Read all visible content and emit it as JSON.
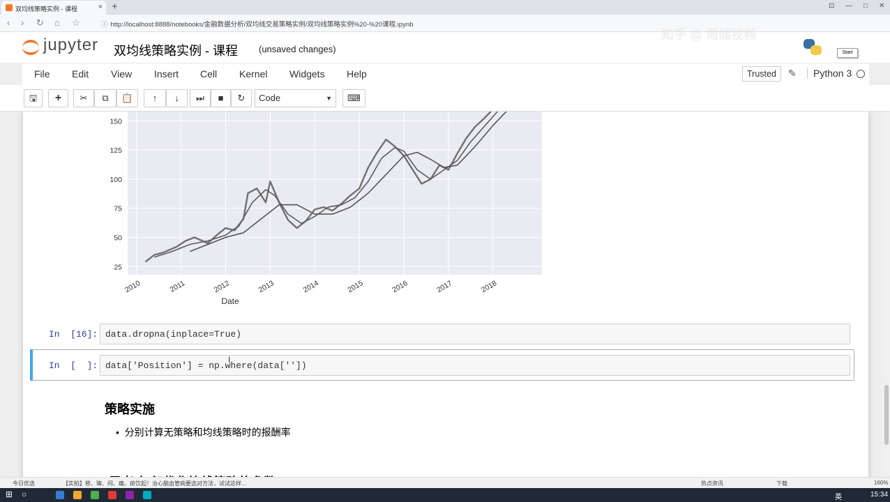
{
  "browser": {
    "tab_title": "双均线策略实例 - 课程",
    "tab_close": "×",
    "new_tab": "+",
    "url_lock": "ⓘ",
    "url": "http://localhost:8888/notebooks/金融数据分析/双均线交易策略实例/双均线策略实例%20-%20课程.ipynb",
    "watermark": "知乎 @ 周储视频"
  },
  "header": {
    "logo_text": "jupyter",
    "notebook_title": "双均线策略实例 - 课程",
    "save_status": "(unsaved changes)",
    "start_button": "Start"
  },
  "menubar": {
    "items": [
      "File",
      "Edit",
      "View",
      "Insert",
      "Cell",
      "Kernel",
      "Widgets",
      "Help"
    ],
    "trusted": "Trusted",
    "kernel_name": "Python 3"
  },
  "toolbar": {
    "cell_type": "Code"
  },
  "chart_data": {
    "type": "line",
    "xlabel": "Date",
    "ylabel": "",
    "x_ticks": [
      "2010",
      "2011",
      "2012",
      "2013",
      "2014",
      "2015",
      "2016",
      "2017",
      "2018"
    ],
    "y_ticks": [
      25,
      50,
      75,
      100,
      125,
      150
    ],
    "ylim": [
      18,
      158
    ],
    "xlim": [
      2009.8,
      2019.1
    ],
    "grid": true,
    "series": [
      {
        "kind": "price",
        "x": [
          2010.2,
          2010.4,
          2010.6,
          2010.9,
          2011.1,
          2011.3,
          2011.6,
          2011.8,
          2012.0,
          2012.2,
          2012.4,
          2012.5,
          2012.7,
          2012.9,
          2013.0,
          2013.2,
          2013.4,
          2013.6,
          2013.8,
          2014.0,
          2014.2,
          2014.4,
          2014.6,
          2014.8,
          2015.0,
          2015.2,
          2015.4,
          2015.6,
          2015.8,
          2016.0,
          2016.2,
          2016.4,
          2016.6,
          2016.8,
          2017.0,
          2017.2,
          2017.4,
          2017.6,
          2017.8,
          2018.0,
          2018.2
        ],
        "y": [
          29,
          35,
          37,
          42,
          47,
          50,
          45,
          52,
          58,
          56,
          66,
          88,
          92,
          80,
          98,
          80,
          65,
          58,
          64,
          74,
          76,
          73,
          79,
          86,
          92,
          110,
          123,
          134,
          128,
          120,
          108,
          96,
          100,
          112,
          108,
          122,
          135,
          145,
          152,
          160,
          165
        ]
      },
      {
        "kind": "short_ma",
        "x": [
          2010.4,
          2010.8,
          2011.2,
          2011.6,
          2012.0,
          2012.3,
          2012.6,
          2012.9,
          2013.1,
          2013.4,
          2013.7,
          2014.0,
          2014.3,
          2014.6,
          2014.9,
          2015.2,
          2015.5,
          2015.8,
          2016.0,
          2016.3,
          2016.6,
          2016.9,
          2017.2,
          2017.5,
          2017.8,
          2018.1
        ],
        "y": [
          33,
          38,
          44,
          47,
          52,
          60,
          80,
          91,
          86,
          70,
          62,
          68,
          76,
          78,
          84,
          98,
          118,
          127,
          124,
          108,
          100,
          108,
          116,
          132,
          145,
          158
        ]
      },
      {
        "kind": "long_ma",
        "x": [
          2011.2,
          2011.6,
          2012.0,
          2012.4,
          2012.8,
          2013.2,
          2013.6,
          2014.0,
          2014.4,
          2014.8,
          2015.2,
          2015.6,
          2016.0,
          2016.3,
          2016.6,
          2016.9,
          2017.2,
          2017.6,
          2018.0,
          2018.3
        ],
        "y": [
          38,
          44,
          50,
          54,
          66,
          78,
          78,
          70,
          70,
          76,
          88,
          104,
          120,
          123,
          117,
          110,
          112,
          128,
          146,
          158
        ]
      }
    ]
  },
  "cells": {
    "c16_prompt": "In  [16]:",
    "c16_code": "data.dropna(inplace=True)",
    "cnew_prompt": "In  [  ]:",
    "cnew_code": "data['Position'] = np.where(data[''])"
  },
  "markdown": {
    "heading": "策略实施",
    "bullet": "分别计算无策略和均线策略时的报酬率",
    "next_heading": "[思考]如何优化均线策略的参数"
  },
  "status_strip": {
    "left": "今日优选",
    "news": "【实拍】慈、瑋、闷、痛、痰饮起！治心脑血管病要选对方法，试试这样...",
    "right_1": "热点资讯",
    "right_2": "下载",
    "zoom": "160%"
  },
  "taskbar": {
    "lang": "英",
    "time": "15:34"
  },
  "colors": {
    "jupyter_orange": "#f37726",
    "prompt_blue": "#303f9f",
    "selected_cell_bar": "#42a5f5",
    "plot_bg": "#eaeaf2",
    "line": "#6d6d6d"
  }
}
